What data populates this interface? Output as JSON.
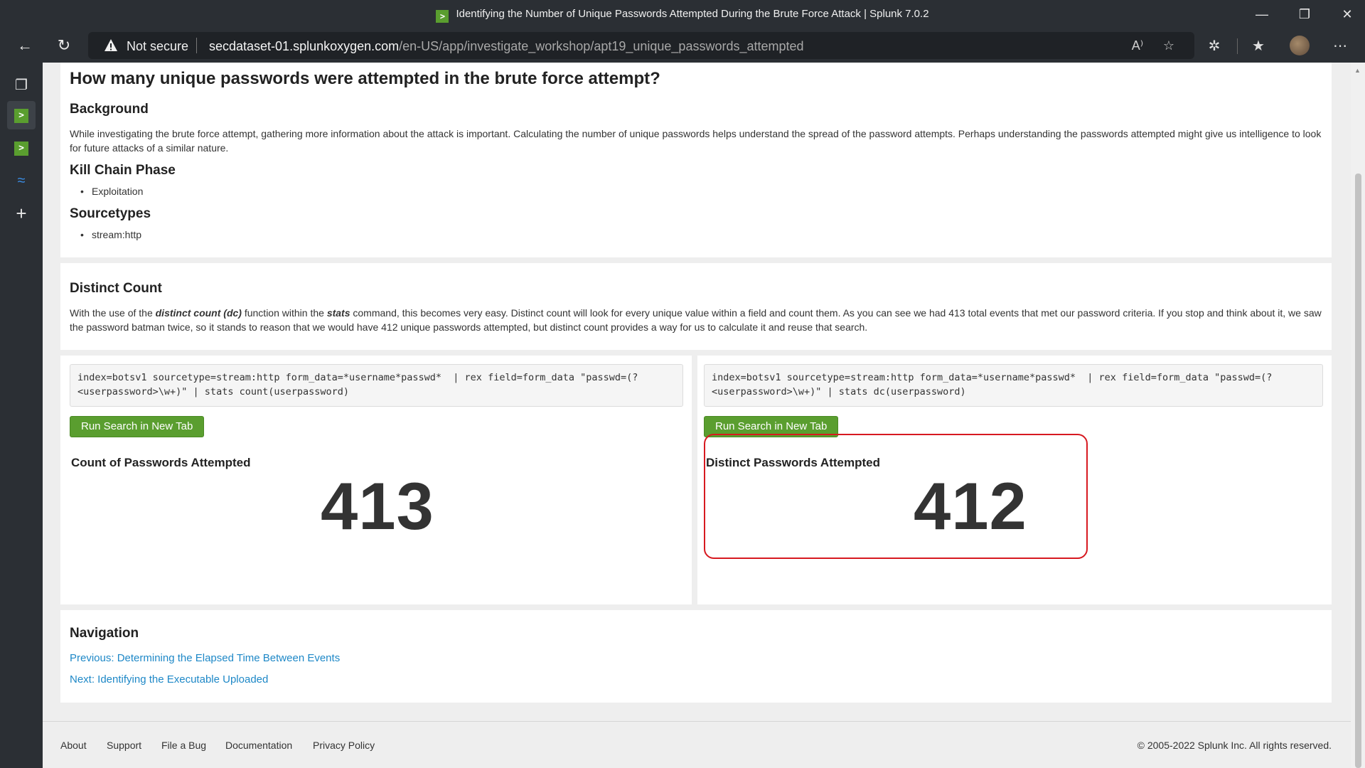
{
  "browser": {
    "window_title": "Identifying the Number of Unique Passwords Attempted During the Brute Force Attack | Splunk 7.0.2",
    "tab_icon": ">",
    "security_label": "Not secure",
    "url_host": "secdataset-01.splunkoxygen.com",
    "url_path": "/en-US/app/investigate_workshop/apt19_unique_passwords_attempted"
  },
  "intro": {
    "question": "How many unique passwords were attempted in the brute force attempt?",
    "background_heading": "Background",
    "background_text": "While investigating the brute force attempt, gathering more information about the attack is important. Calculating the number of unique passwords helps understand the spread of the password attempts. Perhaps understanding the passwords attempted might give us intelligence to look for future attacks of a similar nature.",
    "killchain_heading": "Kill Chain Phase",
    "killchain_items": [
      "Exploitation"
    ],
    "sourcetypes_heading": "Sourcetypes",
    "sourcetypes_items": [
      "stream:http"
    ]
  },
  "distinct": {
    "heading": "Distinct Count",
    "text_1": "With the use of the ",
    "text_em": "distinct count (dc)",
    "text_2": " function within the ",
    "text_stats": "stats",
    "text_3": " command, this becomes very easy. Distinct count will look for every unique value within a field and count them. As you can see we had 413 total events that met our password criteria. If you stop and think about it, we saw the password batman twice, so it stands to reason that we would have 412 unique passwords attempted, but distinct count provides a way for us to calculate it and reuse that search."
  },
  "left_panel": {
    "query": "index=botsv1 sourcetype=stream:http form_data=*username*passwd*  | rex field=form_data \"passwd=(?<userpassword>\\w+)\" | stats count(userpassword)",
    "button": "Run Search in New Tab",
    "title": "Count of Passwords Attempted",
    "value": "413"
  },
  "right_panel": {
    "query": "index=botsv1 sourcetype=stream:http form_data=*username*passwd*  | rex field=form_data \"passwd=(?<userpassword>\\w+)\" | stats dc(userpassword)",
    "button": "Run Search in New Tab",
    "title": "Distinct Passwords Attempted",
    "value": "412"
  },
  "navigation": {
    "heading": "Navigation",
    "previous": "Previous: Determining the Elapsed Time Between Events",
    "next": "Next: Identifying the Executable Uploaded"
  },
  "footer": {
    "links": [
      "About",
      "Support",
      "File a Bug",
      "Documentation",
      "Privacy Policy"
    ],
    "copyright": "© 2005-2022 Splunk Inc. All rights reserved."
  },
  "colors": {
    "splunk_green": "#5a9e2f",
    "link_blue": "#1e88c7",
    "highlight_red": "#d71920"
  }
}
